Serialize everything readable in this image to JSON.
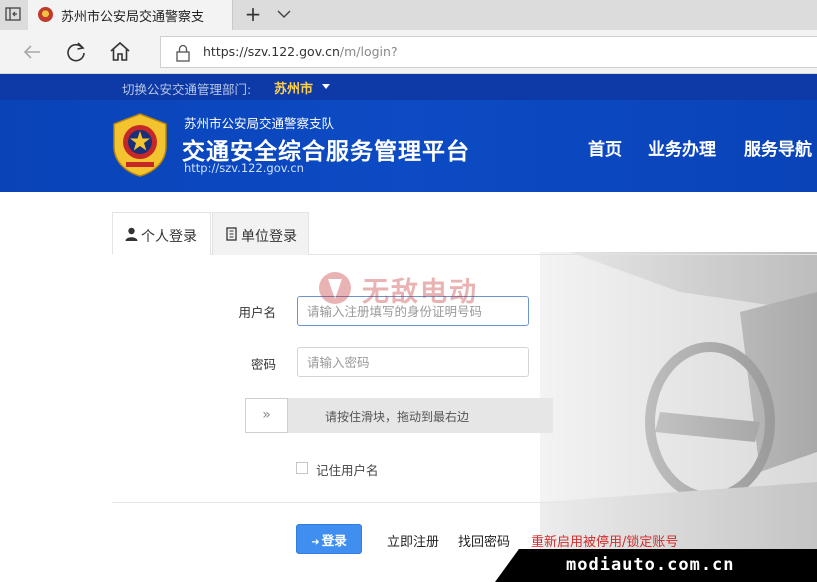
{
  "browser": {
    "tab_title": "苏州市公安局交通警察支",
    "new_tab_symbol": "+",
    "url_host": "https://szv.122.gov.cn",
    "url_path": "/m/login?"
  },
  "site": {
    "switch_label": "切换公安交通管理部门:",
    "city": "苏州市",
    "department": "苏州市公安局交通警察支队",
    "platform_name": "交通安全综合服务管理平台",
    "site_url": "http://szv.122.gov.cn",
    "nav": [
      "首页",
      "业务办理",
      "服务导航"
    ]
  },
  "login": {
    "tabs": [
      {
        "label": "个人登录",
        "active": true
      },
      {
        "label": "单位登录",
        "active": false
      }
    ],
    "username_label": "用户名",
    "username_placeholder": "请输入注册填写的身份证明号码",
    "password_label": "密码",
    "password_placeholder": "请输入密码",
    "slider_handle": "»",
    "slider_hint": "请按住滑块，拖动到最右边",
    "remember_label": "记住用户名",
    "remember_checked": false,
    "login_button": "登录",
    "links": {
      "register": "立即注册",
      "recover": "找回密码",
      "reactivate": "重新启用被停用/锁定账号"
    }
  },
  "watermark": {
    "text": "无敌电动"
  },
  "corner_watermark": "modiauto.com.cn",
  "colors": {
    "header_blue": "#0c4bc4",
    "strip_blue": "#0d3aa6",
    "city_yellow": "#ffd24a",
    "login_button": "#3f8ef0",
    "warning_link": "#d22b2b"
  }
}
